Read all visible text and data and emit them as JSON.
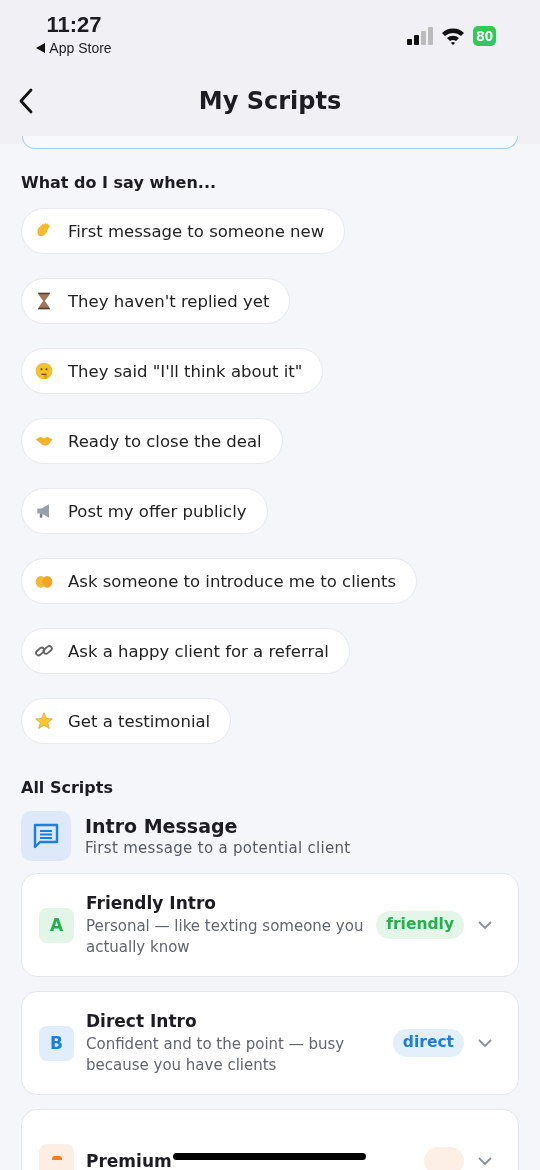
{
  "status_bar": {
    "time": "11:27",
    "back_label": "App Store",
    "battery": "80"
  },
  "nav": {
    "title": "My Scripts"
  },
  "prompts": {
    "heading": "What do I say when...",
    "items": [
      {
        "label": "First message to someone new"
      },
      {
        "label": "They haven't replied yet"
      },
      {
        "label": "They said \"I'll think about it\""
      },
      {
        "label": "Ready to close the deal"
      },
      {
        "label": "Post my offer publicly"
      },
      {
        "label": "Ask someone to introduce me to clients"
      },
      {
        "label": "Ask a happy client for a referral"
      },
      {
        "label": "Get a testimonial"
      }
    ]
  },
  "all_scripts": {
    "heading": "All Scripts",
    "group": {
      "title": "Intro Message",
      "subtitle": "First message to a potential client"
    },
    "scripts": [
      {
        "letter": "A",
        "title": "Friendly Intro",
        "description": "Personal — like texting someone you actually know",
        "tag": "friendly",
        "color": "#22b14c",
        "expanded": false
      },
      {
        "letter": "B",
        "title": "Direct Intro",
        "description": "Confident and to the point — busy because you have clients",
        "tag": "direct",
        "color": "#1a7fe0",
        "expanded": false
      },
      {
        "title": "Premium",
        "color": "#f07c2c",
        "expanded": false
      }
    ]
  }
}
